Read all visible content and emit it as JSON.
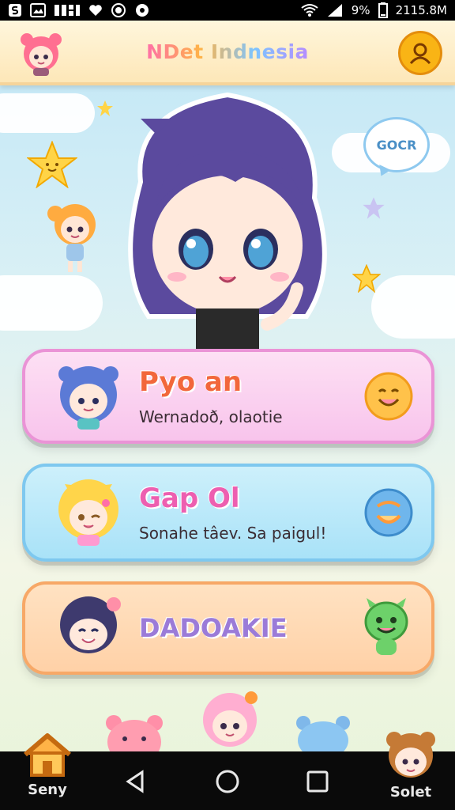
{
  "status_bar": {
    "battery": "9%",
    "time": "2115.8M"
  },
  "header": {
    "title": "NDet Indnesia",
    "avatar_icon": "pink-hair-girl-icon",
    "profile_icon": "user-icon"
  },
  "hero": {
    "speech_bubble": "GOCR"
  },
  "cards": [
    {
      "title": "Pyo an",
      "subtitle": "Wernadoð, olaotie",
      "avatar_icon": "blue-hair-girl-icon",
      "action_icon": "smiley-face-icon"
    },
    {
      "title": "Gap Ol",
      "subtitle": "Sonahe tâev. Sa paigul!",
      "avatar_icon": "blonde-girl-icon",
      "action_icon": "blue-smile-icon"
    },
    {
      "title": "DADOAKIE",
      "subtitle": "",
      "avatar_icon": "dark-hair-boy-icon",
      "action_icon": "green-monster-icon"
    }
  ],
  "bottom_nav": {
    "home_label": "Seny",
    "profile_label": "Solet",
    "back_icon": "back-triangle-icon",
    "home_circle_icon": "home-circle-icon",
    "recents_icon": "recents-square-icon"
  },
  "colors": {
    "header_bg": "#fde7b8",
    "pink_card": "#f8c4ec",
    "blue_card": "#a9e2f8",
    "orange_card": "#ffd1a7",
    "accent_yellow": "#f9b415"
  }
}
